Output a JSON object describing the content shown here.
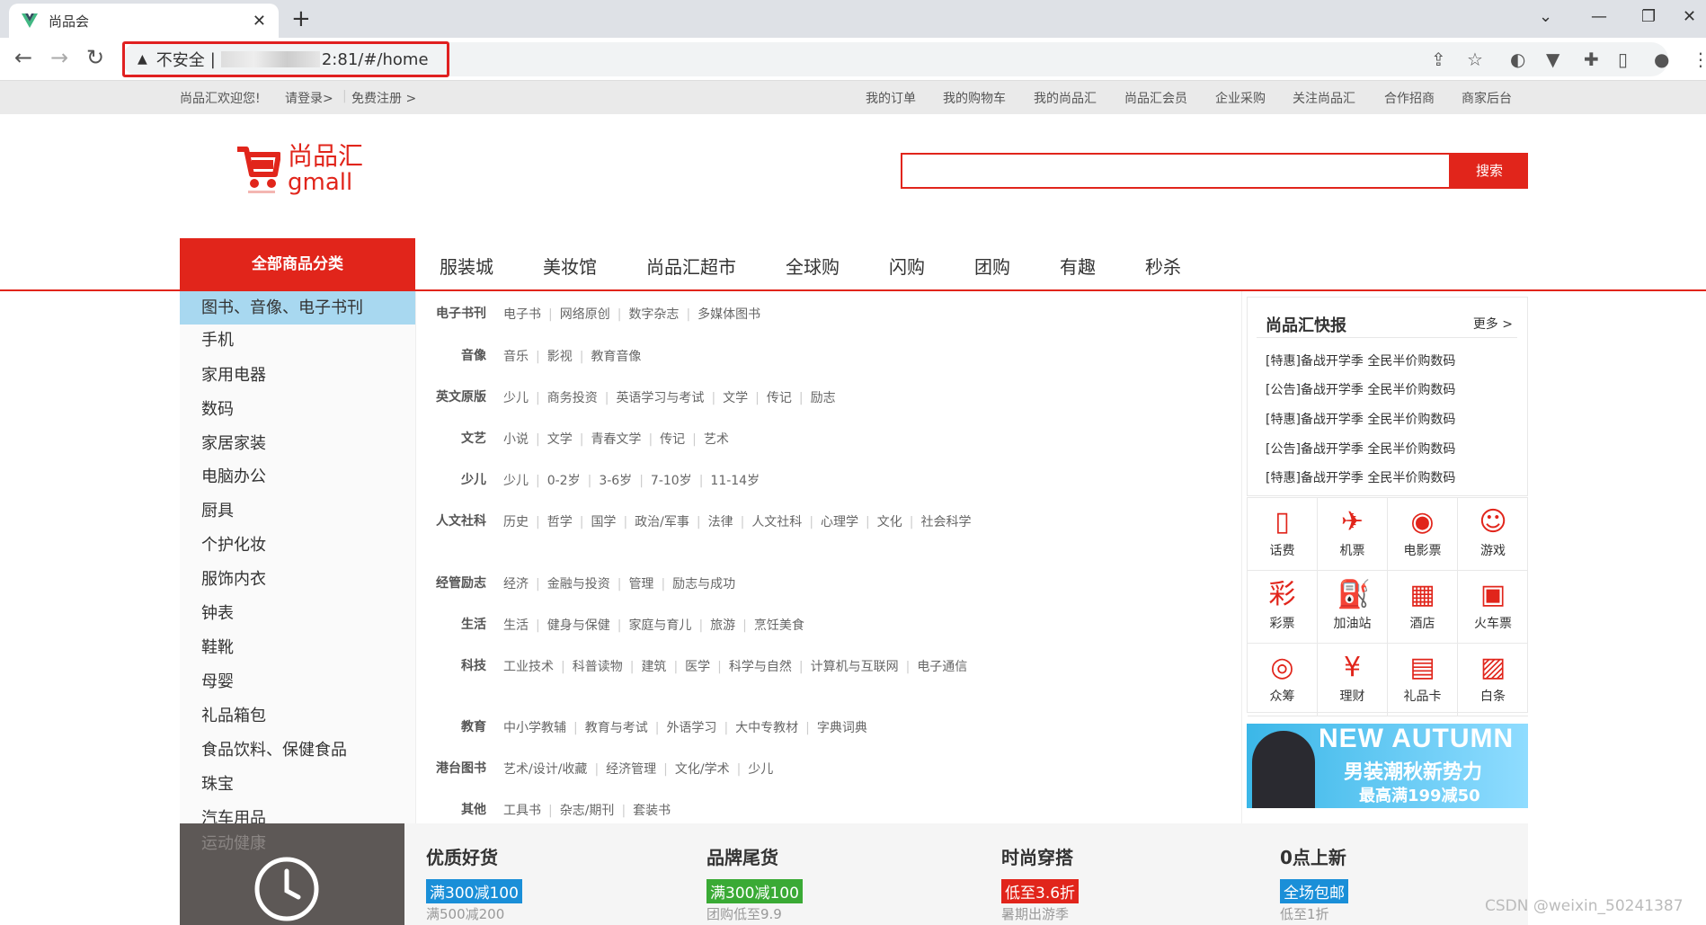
{
  "browser": {
    "tab_title": "尚品会",
    "url_warning": "不安全",
    "url_sep": "|",
    "url_tail": "2:81/#/home"
  },
  "topbar": {
    "welcome": "尚品汇欢迎您!",
    "login": "请登录>",
    "sep": "|",
    "register": "免费注册 >",
    "links": [
      "我的订单",
      "我的购物车",
      "我的尚品汇",
      "尚品汇会员",
      "企业采购",
      "关注尚品汇",
      "合作招商",
      "商家后台"
    ]
  },
  "logo": {
    "cn": "尚品汇",
    "en": "gmall"
  },
  "search": {
    "button": "搜索",
    "value": ""
  },
  "nav": {
    "all_categories": "全部商品分类",
    "items": [
      "服装城",
      "美妆馆",
      "尚品汇超市",
      "全球购",
      "闪购",
      "团购",
      "有趣",
      "秒杀"
    ]
  },
  "sidebar": [
    "图书、音像、电子书刊",
    "手机",
    "家用电器",
    "数码",
    "家居家装",
    "电脑办公",
    "厨具",
    "个护化妆",
    "服饰内衣",
    "钟表",
    "鞋靴",
    "母婴",
    "礼品箱包",
    "食品饮料、保健食品",
    "珠宝",
    "汽车用品",
    "运动健康"
  ],
  "panel": [
    {
      "label": "电子书刊",
      "items": [
        "电子书",
        "网络原创",
        "数字杂志",
        "多媒体图书"
      ]
    },
    {
      "label": "音像",
      "items": [
        "音乐",
        "影视",
        "教育音像"
      ]
    },
    {
      "label": "英文原版",
      "items": [
        "少儿",
        "商务投资",
        "英语学习与考试",
        "文学",
        "传记",
        "励志"
      ]
    },
    {
      "label": "文艺",
      "items": [
        "小说",
        "文学",
        "青春文学",
        "传记",
        "艺术"
      ]
    },
    {
      "label": "少儿",
      "items": [
        "少儿",
        "0-2岁",
        "3-6岁",
        "7-10岁",
        "11-14岁"
      ]
    },
    {
      "label": "人文社科",
      "items": [
        "历史",
        "哲学",
        "国学",
        "政治/军事",
        "法律",
        "人文社科",
        "心理学",
        "文化",
        "社会科学"
      ]
    },
    {
      "label": "经管励志",
      "items": [
        "经济",
        "金融与投资",
        "管理",
        "励志与成功"
      ]
    },
    {
      "label": "生活",
      "items": [
        "生活",
        "健身与保健",
        "家庭与育儿",
        "旅游",
        "烹饪美食"
      ]
    },
    {
      "label": "科技",
      "items": [
        "工业技术",
        "科普读物",
        "建筑",
        "医学",
        "科学与自然",
        "计算机与互联网",
        "电子通信"
      ]
    },
    {
      "label": "教育",
      "items": [
        "中小学教辅",
        "教育与考试",
        "外语学习",
        "大中专教材",
        "字典词典"
      ]
    },
    {
      "label": "港台图书",
      "items": [
        "艺术/设计/收藏",
        "经济管理",
        "文化/学术",
        "少儿"
      ]
    },
    {
      "label": "其他",
      "items": [
        "工具书",
        "杂志/期刊",
        "套装书"
      ]
    }
  ],
  "news": {
    "title": "尚品汇快报",
    "more": "更多 >",
    "items": [
      "[特惠]备战开学季 全民半价购数码",
      "[公告]备战开学季 全民半价购数码",
      "[特惠]备战开学季 全民半价购数码",
      "[公告]备战开学季 全民半价购数码",
      "[特惠]备战开学季 全民半价购数码"
    ]
  },
  "services": [
    {
      "label": "话费",
      "icon": "phone-icon"
    },
    {
      "label": "机票",
      "icon": "plane-icon"
    },
    {
      "label": "电影票",
      "icon": "film-icon"
    },
    {
      "label": "游戏",
      "icon": "gamepad-icon"
    },
    {
      "label": "彩票",
      "icon": "lottery-icon"
    },
    {
      "label": "加油站",
      "icon": "fuel-icon"
    },
    {
      "label": "酒店",
      "icon": "hotel-icon"
    },
    {
      "label": "火车票",
      "icon": "train-icon"
    },
    {
      "label": "众筹",
      "icon": "crowdfund-icon"
    },
    {
      "label": "理财",
      "icon": "finance-icon"
    },
    {
      "label": "礼品卡",
      "icon": "giftcard-icon"
    },
    {
      "label": "白条",
      "icon": "credit-icon"
    }
  ],
  "banner": {
    "line1": "NEW AUTUMN",
    "line2": "男装潮秋新势力",
    "line3": "最高满199减50"
  },
  "promos": [
    {
      "title": "优质好货",
      "badge": "满300减100",
      "badge_color": "#1a8fd8",
      "sub": "满500减200"
    },
    {
      "title": "品牌尾货",
      "badge": "满300减100",
      "badge_color": "#3aaa35",
      "sub": "团购低至9.9"
    },
    {
      "title": "时尚穿搭",
      "badge": "低至3.6折",
      "badge_color": "#e1251b",
      "sub": "暑期出游季"
    },
    {
      "title": "0点上新",
      "badge": "全场包邮",
      "badge_color": "#1a8fd8",
      "sub": "低至1折"
    }
  ],
  "watermark": "CSDN @weixin_50241387",
  "colors": {
    "brand": "#e1251b",
    "sidebar_active": "#a8d8f0"
  }
}
